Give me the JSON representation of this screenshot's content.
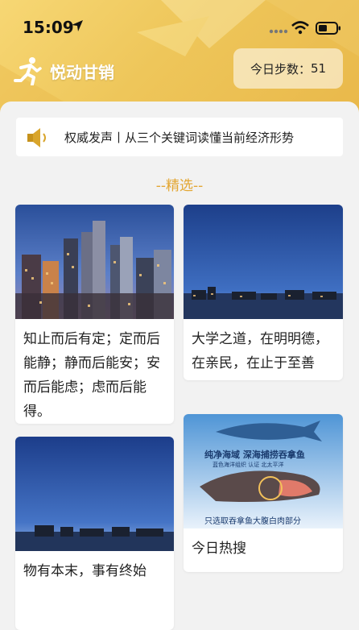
{
  "status_bar": {
    "time": "15:09"
  },
  "app": {
    "title": "悦动甘销",
    "steps_label": "今日步数：",
    "steps_value": "51"
  },
  "notice": {
    "text": "权威发声丨从三个关键词读懂当前经济形势"
  },
  "section": {
    "title": "--精选--"
  },
  "cards": [
    {
      "text": "知止而后有定；定而后能静；静而后能安；安而后能虑；虑而后能得。"
    },
    {
      "text": "大学之道，在明明德，在亲民，在止于至善"
    },
    {
      "text": "物有本末，事有终始"
    },
    {
      "text": "今日热搜",
      "image_text": {
        "line1": "纯净海域 深海捕捞吞拿鱼",
        "line2": "蓝色海洋组织 认证  北太平洋",
        "bottom": "只选取吞拿鱼大腹白肉部分"
      }
    }
  ],
  "colors": {
    "accent": "#e3a632",
    "header": "#eec65a"
  }
}
